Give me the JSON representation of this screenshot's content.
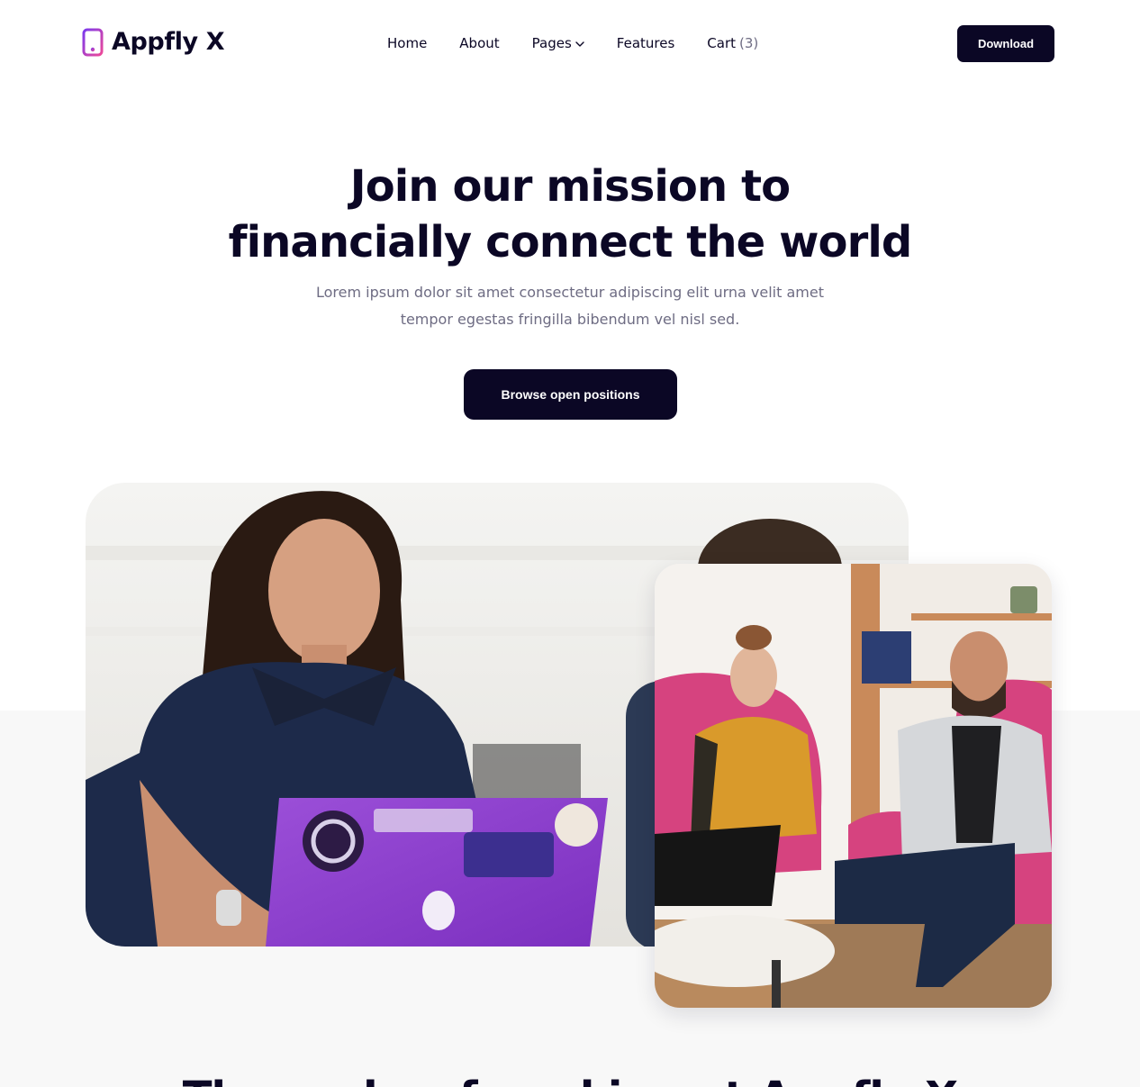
{
  "brand": {
    "name": "Appfly X",
    "logo_icon": "phone-icon",
    "accent_gradient": [
      "#7c3aed",
      "#ec4899"
    ]
  },
  "nav": {
    "items": [
      {
        "label": "Home"
      },
      {
        "label": "About"
      },
      {
        "label": "Pages"
      },
      {
        "label": "Features"
      },
      {
        "label": "Cart"
      }
    ],
    "cart_count": "(3)",
    "pages_icon": "chevron-down-icon"
  },
  "header": {
    "download_label": "Download"
  },
  "hero": {
    "title_line1": "Join our mission to",
    "title_line2": "financially connect the world",
    "subtitle_line1": "Lorem ipsum dolor sit amet consectetur adipiscing elit urna velit amet",
    "subtitle_line2": "tempor egestas fringilla bibendum vel nisl sed.",
    "cta_label": "Browse open positions"
  },
  "next_section": {
    "heading": "The perks of working at Appfly X"
  },
  "colors": {
    "primary": "#0b0725",
    "muted_text": "#6e6c83",
    "band": "#f8f8f8"
  }
}
